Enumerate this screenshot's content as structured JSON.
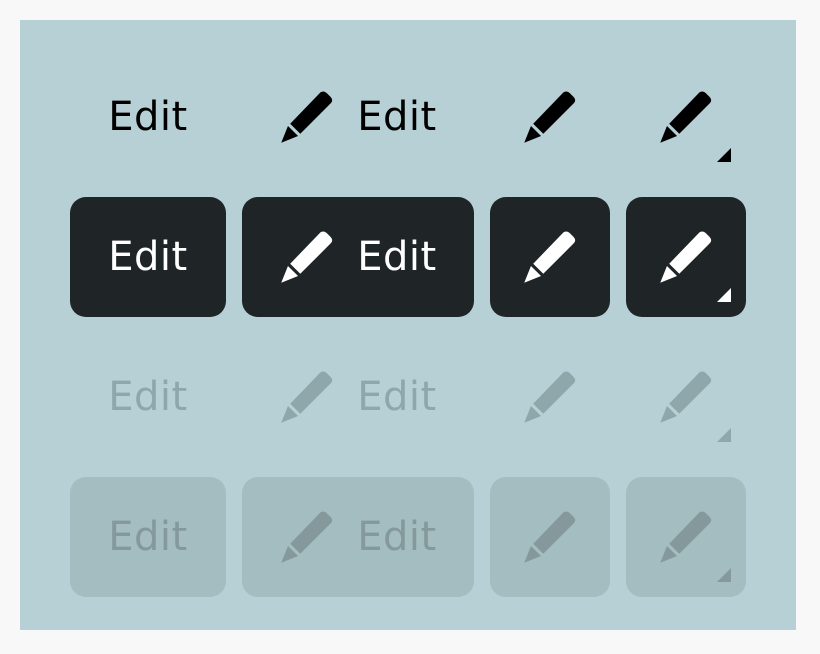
{
  "colors": {
    "page_background": "#f8f8f8",
    "panel_background": "#b6d0d5",
    "solid_button": "#1f2426",
    "solid_text": "#ffffff",
    "quiet_text": "#000000",
    "disabled_text": "#8fa7aa",
    "disabled_fill": "#a3bdc0"
  },
  "icons": {
    "edit": "pencil-icon",
    "hold_indicator": "corner-triangle-icon"
  },
  "rows": [
    {
      "name": "quiet",
      "label": "Edit",
      "disabled": false
    },
    {
      "name": "solid",
      "label": "Edit",
      "disabled": false
    },
    {
      "name": "quiet-disabled",
      "label": "Edit",
      "disabled": true
    },
    {
      "name": "solid-disabled",
      "label": "Edit",
      "disabled": true
    }
  ]
}
